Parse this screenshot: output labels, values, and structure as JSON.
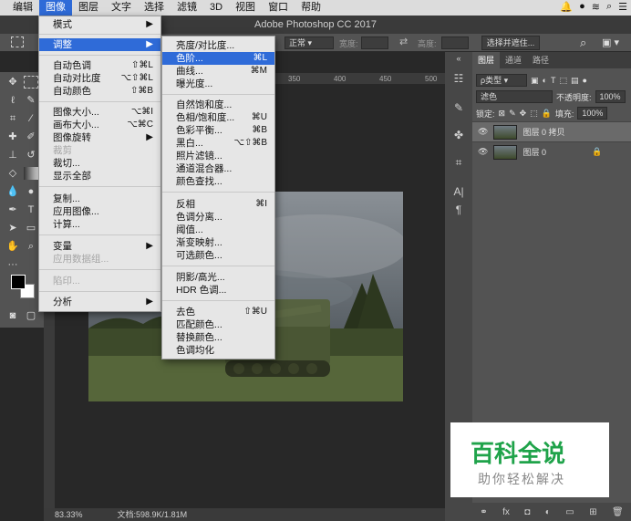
{
  "menubar": {
    "items": [
      "编辑",
      "图像",
      "图层",
      "文字",
      "选择",
      "滤镜",
      "3D",
      "视图",
      "窗口",
      "帮助"
    ]
  },
  "app_title": "Adobe Photoshop CC 2017",
  "options_bar": {
    "style_label": "正常",
    "width_label": "宽度:",
    "height_label": "高度:",
    "select_mask_button": "选择并遮住..."
  },
  "ruler_ticks": [
    "350",
    "400",
    "450",
    "500"
  ],
  "image_menu": [
    {
      "label": "模式",
      "submenu": true
    },
    {
      "label": "调整",
      "submenu": true,
      "highlighted": true
    },
    {
      "label": "自动色调",
      "shortcut": "⇧⌘L"
    },
    {
      "label": "自动对比度",
      "shortcut": "⌥⇧⌘L"
    },
    {
      "label": "自动颜色",
      "shortcut": "⇧⌘B"
    },
    {
      "label": "图像大小...",
      "shortcut": "⌥⌘I"
    },
    {
      "label": "画布大小...",
      "shortcut": "⌥⌘C"
    },
    {
      "label": "图像旋转",
      "submenu": true
    },
    {
      "label": "裁剪",
      "disabled": true
    },
    {
      "label": "裁切..."
    },
    {
      "label": "显示全部"
    },
    {
      "label": "复制..."
    },
    {
      "label": "应用图像..."
    },
    {
      "label": "计算..."
    },
    {
      "label": "变量",
      "submenu": true
    },
    {
      "label": "应用数据组...",
      "disabled": true
    },
    {
      "label": "陷印...",
      "disabled": true
    },
    {
      "label": "分析",
      "submenu": true
    }
  ],
  "adjust_menu": [
    {
      "label": "亮度/对比度..."
    },
    {
      "label": "色阶...",
      "shortcut": "⌘L",
      "highlighted": true
    },
    {
      "label": "曲线...",
      "shortcut": "⌘M"
    },
    {
      "label": "曝光度..."
    },
    {
      "label": "自然饱和度..."
    },
    {
      "label": "色相/饱和度...",
      "shortcut": "⌘U"
    },
    {
      "label": "色彩平衡...",
      "shortcut": "⌘B"
    },
    {
      "label": "黑白...",
      "shortcut": "⌥⇧⌘B"
    },
    {
      "label": "照片滤镜..."
    },
    {
      "label": "通道混合器..."
    },
    {
      "label": "颜色查找..."
    },
    {
      "label": "反相",
      "shortcut": "⌘I"
    },
    {
      "label": "色调分离..."
    },
    {
      "label": "阈值..."
    },
    {
      "label": "渐变映射..."
    },
    {
      "label": "可选颜色..."
    },
    {
      "label": "阴影/高光..."
    },
    {
      "label": "HDR 色调..."
    },
    {
      "label": "去色",
      "shortcut": "⇧⌘U"
    },
    {
      "label": "匹配颜色..."
    },
    {
      "label": "替换颜色..."
    },
    {
      "label": "色调均化"
    }
  ],
  "layers_panel": {
    "tabs": [
      "图层",
      "通道",
      "路径"
    ],
    "filter_label": "ρ类型",
    "blend_mode": "滤色",
    "opacity_label": "不透明度:",
    "opacity_value": "100%",
    "lock_label": "锁定:",
    "fill_label": "填充:",
    "fill_value": "100%",
    "layers": [
      {
        "name": "图层 0 拷贝",
        "selected": true
      },
      {
        "name": "图层 0",
        "locked": true
      }
    ]
  },
  "status": {
    "zoom": "83.33%",
    "doc_info": "文档:598.9K/1.81M"
  },
  "watermark": {
    "title": "百科全说",
    "subtitle": "助你轻松解决"
  }
}
